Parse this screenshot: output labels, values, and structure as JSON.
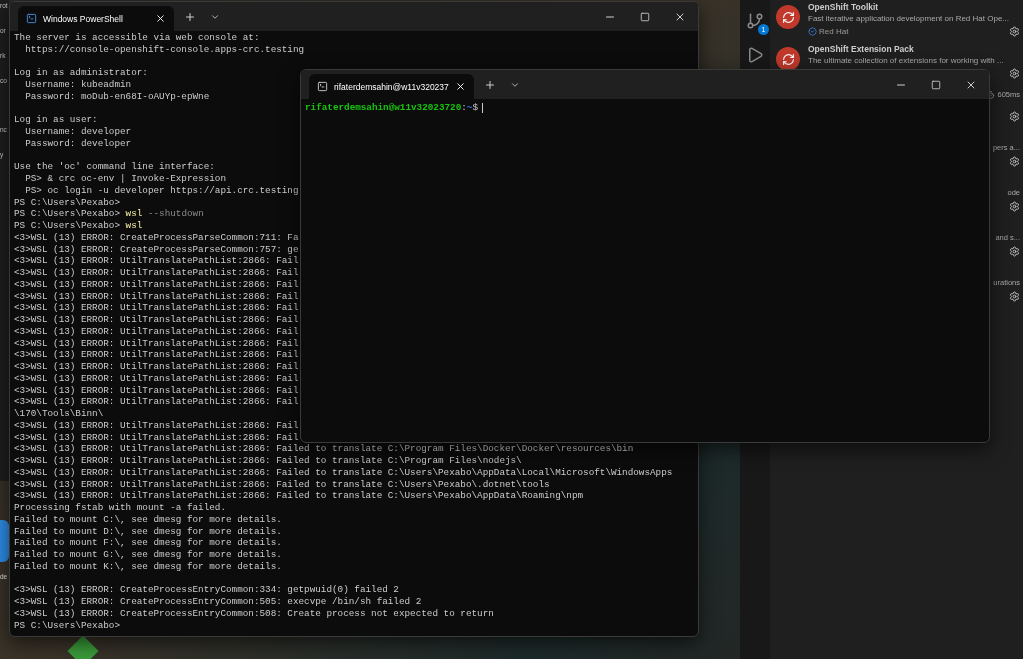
{
  "desktop": {
    "window_fragments": [
      "rot",
      "or",
      "rk",
      "co",
      "nc",
      "y"
    ],
    "icon_caption": "de"
  },
  "vscode": {
    "source_control_badge": "1",
    "extensions": [
      {
        "title": "OpenShift Toolkit",
        "description": "Fast iterative application development on Red Hat Ope...",
        "publisher": "Red Hat"
      },
      {
        "title": "OpenShift Extension Pack",
        "description": "The ultimate collection of extensions for working with ..."
      }
    ],
    "covered_rows": [
      {
        "kind": "timing",
        "text": "605ms"
      },
      {
        "kind": "description",
        "text": "pers a..."
      },
      {
        "kind": "description",
        "text": "ode"
      },
      {
        "kind": "description",
        "text": "and s..."
      },
      {
        "kind": "description",
        "text": "urations"
      }
    ]
  },
  "powershell": {
    "tab_title": "Windows PowerShell",
    "lines": [
      {
        "kind": "output",
        "text": "The server is accessible via web console at:"
      },
      {
        "kind": "output",
        "text": "  https://console-openshift-console.apps-crc.testing"
      },
      {
        "kind": "blank"
      },
      {
        "kind": "output",
        "text": "Log in as administrator:"
      },
      {
        "kind": "output",
        "text": "  Username: kubeadmin"
      },
      {
        "kind": "output",
        "text": "  Password: moDub-en68I-oAUYp-epWne"
      },
      {
        "kind": "blank"
      },
      {
        "kind": "output",
        "text": "Log in as user:"
      },
      {
        "kind": "output",
        "text": "  Username: developer"
      },
      {
        "kind": "output",
        "text": "  Password: developer"
      },
      {
        "kind": "blank"
      },
      {
        "kind": "output",
        "text": "Use the 'oc' command line interface:"
      },
      {
        "kind": "output",
        "text": "  PS> & crc oc-env | Invoke-Expression"
      },
      {
        "kind": "output",
        "text": "  PS> oc login -u developer https://api.crc.testing"
      },
      {
        "kind": "output",
        "text": "PS C:\\Users\\Pexabo>"
      },
      {
        "kind": "command",
        "prompt": "PS C:\\Users\\Pexabo>",
        "command": "wsl",
        "args": "--shutdown"
      },
      {
        "kind": "command",
        "prompt": "PS C:\\Users\\Pexabo>",
        "command": "wsl"
      },
      {
        "kind": "output",
        "text": "<3>WSL (13) ERROR: CreateProcessParseCommon:711: Fa"
      },
      {
        "kind": "output",
        "text": "<3>WSL (13) ERROR: CreateProcessParseCommon:757: ge"
      },
      {
        "kind": "output",
        "text": "<3>WSL (13) ERROR: UtilTranslatePathList:2866: Fail"
      },
      {
        "kind": "output",
        "text": "<3>WSL (13) ERROR: UtilTranslatePathList:2866: Fail"
      },
      {
        "kind": "output",
        "text": "<3>WSL (13) ERROR: UtilTranslatePathList:2866: Fail"
      },
      {
        "kind": "output",
        "text": "<3>WSL (13) ERROR: UtilTranslatePathList:2866: Fail"
      },
      {
        "kind": "output",
        "text": "<3>WSL (13) ERROR: UtilTranslatePathList:2866: Fail"
      },
      {
        "kind": "output",
        "text": "<3>WSL (13) ERROR: UtilTranslatePathList:2866: Fail"
      },
      {
        "kind": "output",
        "text": "<3>WSL (13) ERROR: UtilTranslatePathList:2866: Fail"
      },
      {
        "kind": "output",
        "text": "<3>WSL (13) ERROR: UtilTranslatePathList:2866: Fail"
      },
      {
        "kind": "output",
        "text": "<3>WSL (13) ERROR: UtilTranslatePathList:2866: Fail"
      },
      {
        "kind": "output",
        "text": "<3>WSL (13) ERROR: UtilTranslatePathList:2866: Fail"
      },
      {
        "kind": "output",
        "text": "<3>WSL (13) ERROR: UtilTranslatePathList:2866: Fail"
      },
      {
        "kind": "output",
        "text": "<3>WSL (13) ERROR: UtilTranslatePathList:2866: Fail"
      },
      {
        "kind": "output",
        "text": "<3>WSL (13) ERROR: UtilTranslatePathList:2866: Fail"
      },
      {
        "kind": "output",
        "text": "\\170\\Tools\\Binn\\"
      },
      {
        "kind": "output",
        "text": "<3>WSL (13) ERROR: UtilTranslatePathList:2866: Fail"
      },
      {
        "kind": "output",
        "text": "<3>WSL (13) ERROR: UtilTranslatePathList:2866: Fail"
      },
      {
        "kind": "output",
        "text": "<3>WSL (13) ERROR: UtilTranslatePathList:2866: Failed to translate C:\\Program Files\\Docker\\Docker\\resources\\bin"
      },
      {
        "kind": "output",
        "text": "<3>WSL (13) ERROR: UtilTranslatePathList:2866: Failed to translate C:\\Program Files\\nodejs\\"
      },
      {
        "kind": "output",
        "text": "<3>WSL (13) ERROR: UtilTranslatePathList:2866: Failed to translate C:\\Users\\Pexabo\\AppData\\Local\\Microsoft\\WindowsApps"
      },
      {
        "kind": "output",
        "text": "<3>WSL (13) ERROR: UtilTranslatePathList:2866: Failed to translate C:\\Users\\Pexabo\\.dotnet\\tools"
      },
      {
        "kind": "output",
        "text": "<3>WSL (13) ERROR: UtilTranslatePathList:2866: Failed to translate C:\\Users\\Pexabo\\AppData\\Roaming\\npm"
      },
      {
        "kind": "output",
        "text": "Processing fstab with mount -a failed."
      },
      {
        "kind": "output",
        "text": "Failed to mount C:\\, see dmesg for more details."
      },
      {
        "kind": "output",
        "text": "Failed to mount D:\\, see dmesg for more details."
      },
      {
        "kind": "output",
        "text": "Failed to mount F:\\, see dmesg for more details."
      },
      {
        "kind": "output",
        "text": "Failed to mount G:\\, see dmesg for more details."
      },
      {
        "kind": "output",
        "text": "Failed to mount K:\\, see dmesg for more details."
      },
      {
        "kind": "blank"
      },
      {
        "kind": "output",
        "text": "<3>WSL (13) ERROR: CreateProcessEntryCommon:334: getpwuid(0) failed 2"
      },
      {
        "kind": "output",
        "text": "<3>WSL (13) ERROR: CreateProcessEntryCommon:505: execvpe /bin/sh failed 2"
      },
      {
        "kind": "output",
        "text": "<3>WSL (13) ERROR: CreateProcessEntryCommon:508: Create process not expected to return"
      },
      {
        "kind": "output",
        "text": "PS C:\\Users\\Pexabo>"
      }
    ]
  },
  "linux_terminal": {
    "tab_title": "rifaterdemsahin@w11v320237",
    "user_host": "rifaterdemsahin@w11v32023720",
    "separator": ":",
    "path": "~",
    "prompt_symbol": "$"
  }
}
